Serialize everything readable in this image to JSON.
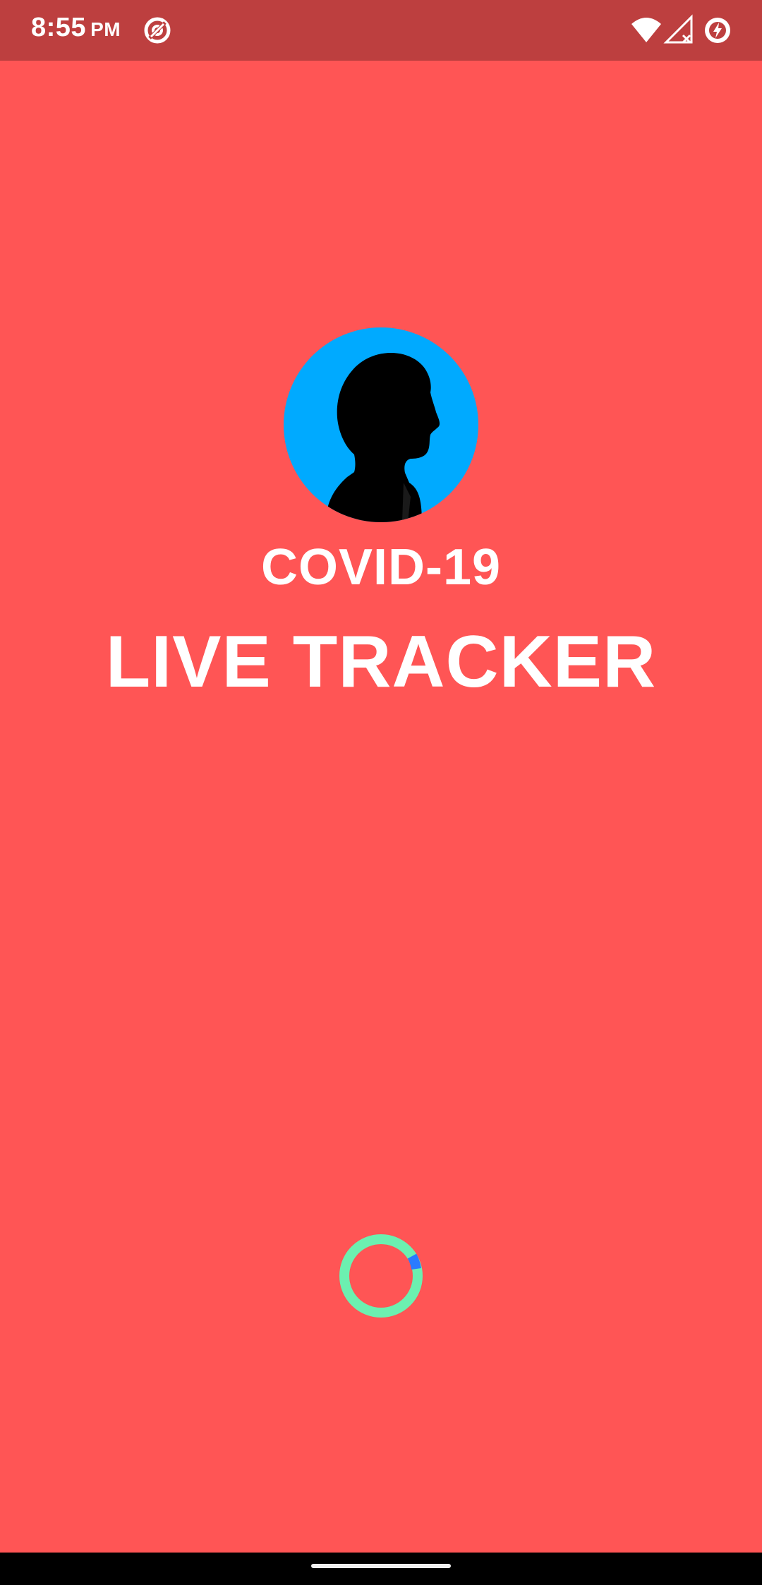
{
  "status_bar": {
    "time": "8:55",
    "ampm": "PM",
    "icons": [
      "data-saver-icon",
      "wifi-icon",
      "signal-no-service-icon",
      "battery-charging-icon"
    ]
  },
  "splash": {
    "title_line1": "COVID-19",
    "title_line2": "LIVE TRACKER",
    "avatar_icon": "person-silhouette-icon",
    "loader_icon": "loading-spinner-icon"
  },
  "colors": {
    "background": "#FF5555",
    "status_bar": "#BD3F3F",
    "avatar_bg": "#00AAFF",
    "spinner_ring": "#6CF0B0",
    "spinner_segment": "#2A7BFF",
    "nav_bar": "#000000"
  }
}
